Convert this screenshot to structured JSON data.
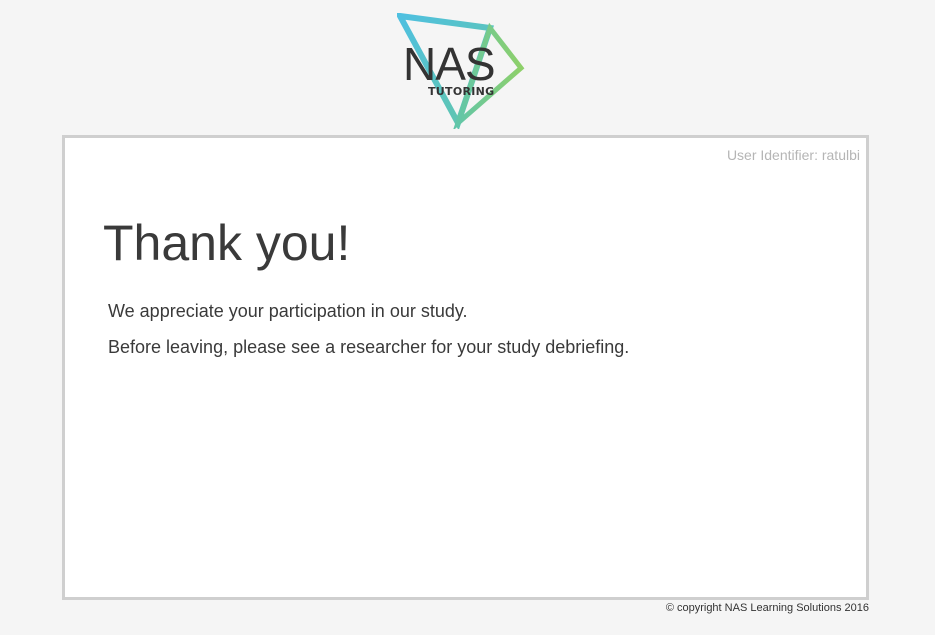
{
  "logo": {
    "main_text": "NAS",
    "sub_text": "TUTORING",
    "colors": {
      "blue": "#4fc0e0",
      "green": "#7ed07a",
      "teal": "#62c6a8",
      "text": "#333333"
    }
  },
  "user_identifier": "User Identifier: ratulbi",
  "main": {
    "title": "Thank you!",
    "line1": "We appreciate your participation in our study.",
    "line2": "Before leaving, please see a researcher for your study debriefing."
  },
  "footer": {
    "copyright": "© copyright NAS Learning Solutions 2016"
  }
}
